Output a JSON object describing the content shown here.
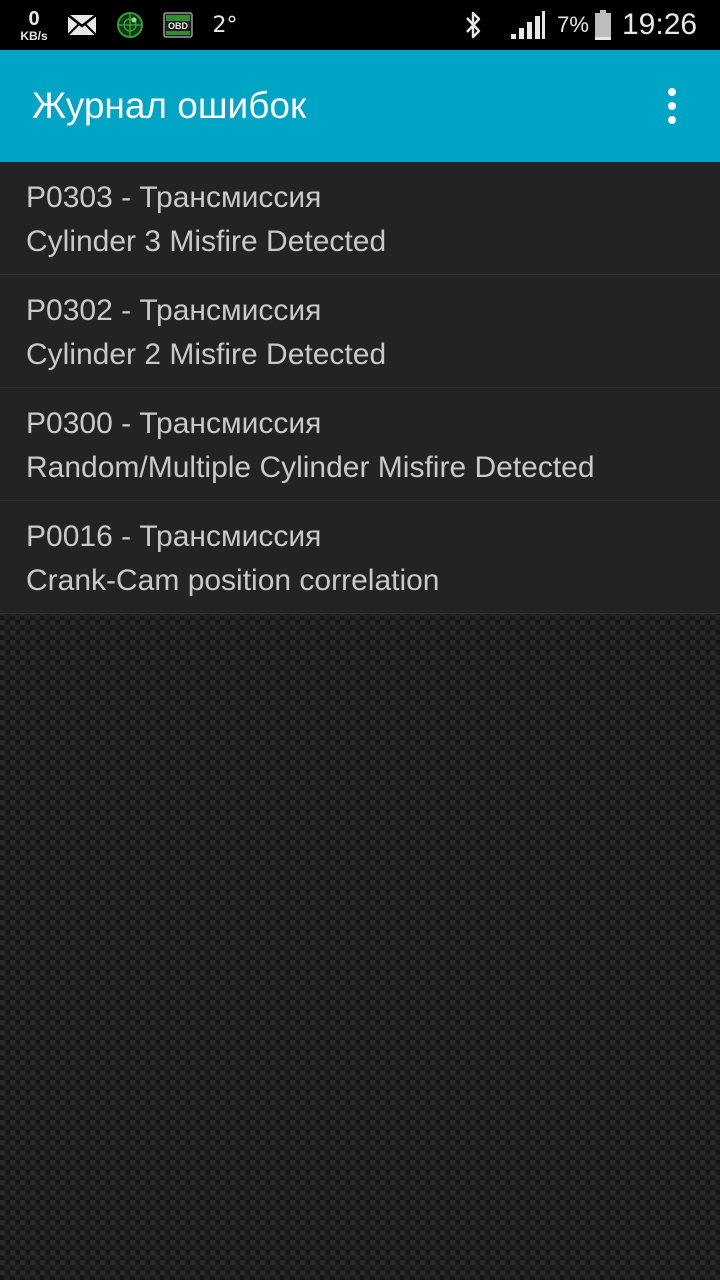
{
  "status_bar": {
    "speed_value": "0",
    "speed_unit": "KB/s",
    "temperature": "2°",
    "battery_percent": "7%",
    "time": "19:26",
    "icons": [
      "mail-icon",
      "radar-icon",
      "obd-icon",
      "bluetooth-icon",
      "signal-icon",
      "battery-icon"
    ]
  },
  "app_bar": {
    "title": "Журнал ошибок",
    "menu_icon": "overflow-menu-icon",
    "color": "#00a4c4"
  },
  "errors": [
    {
      "code_line": "P0303 - Трансмиссия",
      "description": "Cylinder 3 Misfire Detected"
    },
    {
      "code_line": "P0302 - Трансмиссия",
      "description": "Cylinder 2 Misfire Detected"
    },
    {
      "code_line": "P0300 - Трансмиссия",
      "description": "Random/Multiple Cylinder Misfire Detected"
    },
    {
      "code_line": "P0016 - Трансмиссия",
      "description": "Crank-Cam position correlation"
    }
  ]
}
